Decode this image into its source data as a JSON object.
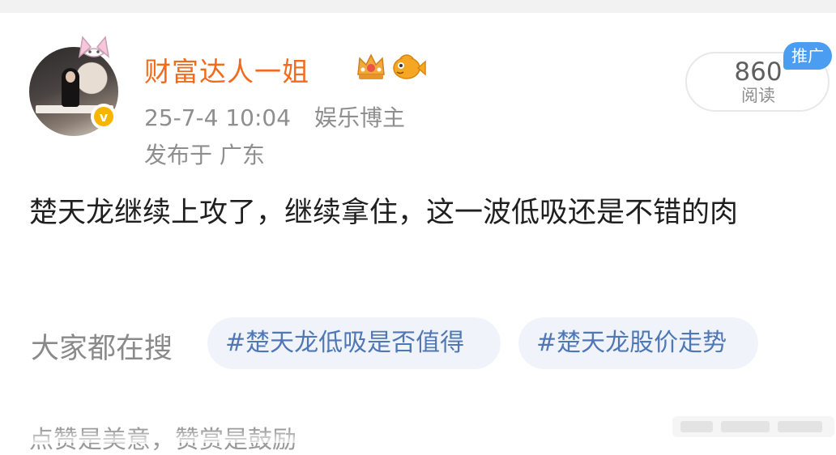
{
  "post": {
    "author": "财富达人一姐",
    "time": "25-7-4 10:04",
    "author_category": "娱乐博主",
    "location": "发布于 广东",
    "read_count": "860",
    "read_label": "阅读",
    "promo_badge": "推广",
    "text": "楚天龙继续上攻了，继续拿住，这一波低吸还是不错的肉"
  },
  "search": {
    "label": "大家都在搜",
    "tags": [
      "#楚天龙低吸是否值得",
      "#楚天龙股价走势"
    ]
  },
  "footer": {
    "text": "点赞是美意，赞赏是鼓励"
  },
  "colors": {
    "username": "#f26b1d",
    "verified_badge": "#f7b500",
    "tag_text": "#4f77b5",
    "tag_bg": "#f0f4fa",
    "promo_badge": "#4a9df0"
  },
  "icons": [
    "cat-ear-icon",
    "verified-badge-icon",
    "crown-badge-icon",
    "fish-badge-icon"
  ]
}
